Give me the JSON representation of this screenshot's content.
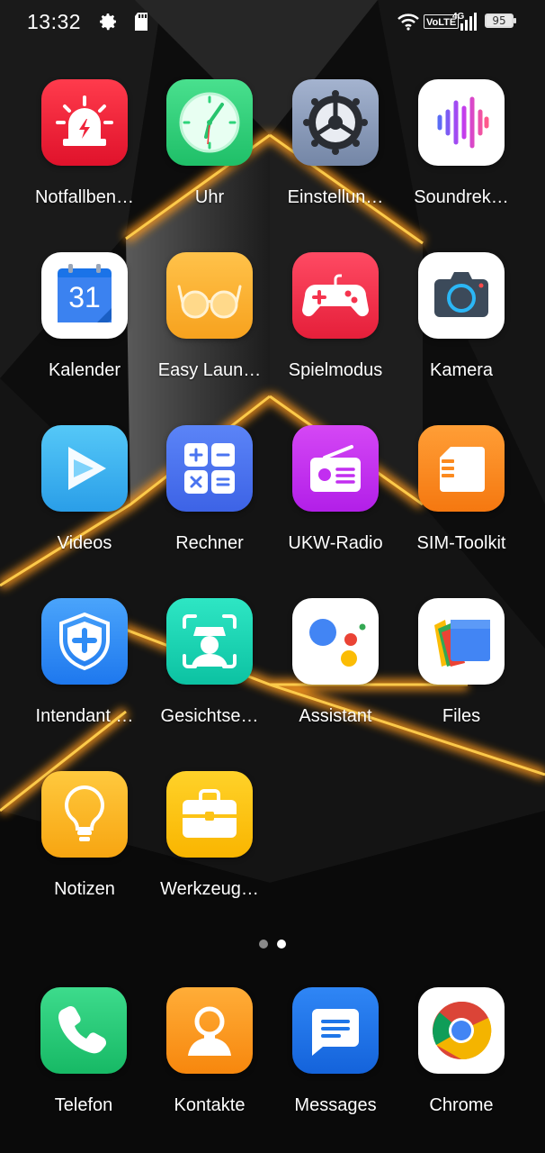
{
  "status_bar": {
    "time": "13:32",
    "left_icons": [
      "gear-icon",
      "sd-card-icon"
    ],
    "right_icons": [
      "wifi-icon",
      "volte-badge",
      "4g-signal-icon",
      "battery-icon"
    ],
    "volte": "VoLTE",
    "network": "4G",
    "battery": "95"
  },
  "apps": [
    {
      "label": "Notfallben…",
      "icon": "emergency-siren-icon",
      "color": "#f0243a"
    },
    {
      "label": "Uhr",
      "icon": "clock-icon",
      "color": "#2ed47a"
    },
    {
      "label": "Einstellun…",
      "icon": "settings-gear-icon",
      "color": "#8a9bb8"
    },
    {
      "label": "Soundrek…",
      "icon": "sound-wave-icon",
      "color": "#ffffff"
    },
    {
      "label": "Kalender",
      "icon": "calendar-icon",
      "color": "#ffffff",
      "day": "31"
    },
    {
      "label": "Easy Laun…",
      "icon": "glasses-icon",
      "color": "#fbb238"
    },
    {
      "label": "Spielmodus",
      "icon": "gamepad-icon",
      "color": "#f5344e"
    },
    {
      "label": "Kamera",
      "icon": "camera-icon",
      "color": "#ffffff"
    },
    {
      "label": "Videos",
      "icon": "play-icon",
      "color": "#39b6f0"
    },
    {
      "label": "Rechner",
      "icon": "calculator-icon",
      "color": "#4a74f0"
    },
    {
      "label": "UKW-Radio",
      "icon": "radio-icon",
      "color": "#c22ef0"
    },
    {
      "label": "SIM-Toolkit",
      "icon": "sim-card-icon",
      "color": "#fb8a1f"
    },
    {
      "label": "Intendant …",
      "icon": "shield-plus-icon",
      "color": "#2f8cf5"
    },
    {
      "label": "Gesichtse…",
      "icon": "face-scan-icon",
      "color": "#14d2b2"
    },
    {
      "label": "Assistant",
      "icon": "google-assistant-icon",
      "color": "#ffffff"
    },
    {
      "label": "Files",
      "icon": "files-folder-icon",
      "color": "#ffffff"
    },
    {
      "label": "Notizen",
      "icon": "lightbulb-icon",
      "color": "#fbb626"
    },
    {
      "label": "Werkzeug…",
      "icon": "toolbox-icon",
      "color": "#fcc316"
    }
  ],
  "page_indicator": {
    "pages": 2,
    "current": 2
  },
  "dock": [
    {
      "label": "Telefon",
      "icon": "phone-icon",
      "color": "#25c97a"
    },
    {
      "label": "Kontakte",
      "icon": "contact-person-icon",
      "color": "#fb9a1c"
    },
    {
      "label": "Messages",
      "icon": "messages-icon",
      "color": "#1f76e8"
    },
    {
      "label": "Chrome",
      "icon": "chrome-icon",
      "color": "#ffffff"
    }
  ]
}
